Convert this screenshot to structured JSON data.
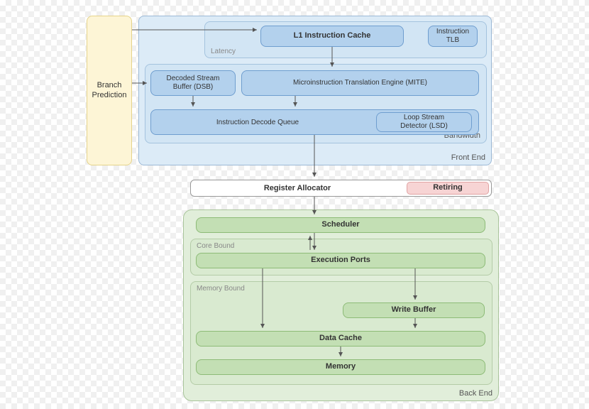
{
  "branch_prediction": "Branch\nPrediction",
  "front_end": {
    "label": "Front End",
    "latency": {
      "group_label": "Latency",
      "l1_icache": "L1 Instruction Cache",
      "itlb": "Instruction\nTLB"
    },
    "bandwidth": {
      "group_label": "Bandwidth",
      "dsb": "Decoded Stream\nBuffer (DSB)",
      "mite": "Microinstruction Translation Engine (MITE)",
      "idq": "Instruction Decode Queue",
      "lsd": "Loop Stream\nDetector (LSD)"
    }
  },
  "register_allocator": "Register Allocator",
  "retiring": "Retiring",
  "back_end": {
    "label": "Back End",
    "scheduler": "Scheduler",
    "core_bound": {
      "group_label": "Core Bound",
      "exec_ports": "Execution Ports"
    },
    "memory_bound": {
      "group_label": "Memory Bound",
      "write_buffer": "Write Buffer",
      "data_cache": "Data Cache",
      "memory": "Memory"
    }
  }
}
